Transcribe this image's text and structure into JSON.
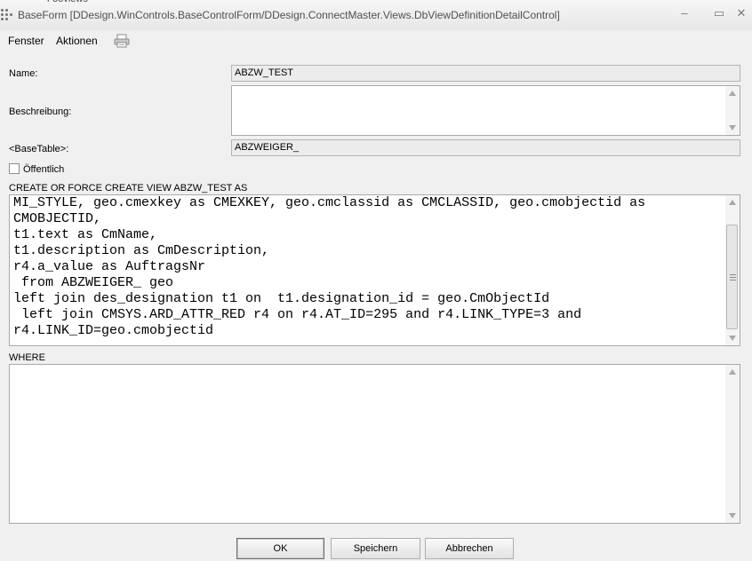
{
  "window": {
    "title": "BaseForm [DDesign.WinControls.BaseControlForm/DDesign.ConnectMaster.Views.DbViewDefinitionDetailControl]",
    "behind_text": "l-ooviews"
  },
  "menu": {
    "items": [
      "Fenster",
      "Aktionen"
    ]
  },
  "form": {
    "name_label": "Name:",
    "name_value": "ABZW_TEST",
    "description_label": "Beschreibung:",
    "description_value": "",
    "basetable_label": "<BaseTable>:",
    "basetable_value": "ABZWEIGER_",
    "public_label": "Öffentlich",
    "public_checked": false,
    "create_label": "CREATE OR FORCE CREATE VIEW ABZW_TEST AS",
    "sql_text": "MI_STYLE, geo.cmexkey as CMEXKEY, geo.cmclassid as CMCLASSID, geo.cmobjectid as\nCMOBJECTID,\nt1.text as CmName,\nt1.description as CmDescription,\nr4.a_value as AuftragsNr\n from ABZWEIGER_ geo\nleft join des_designation t1 on  t1.designation_id = geo.CmObjectId\n left join CMSYS.ARD_ATTR_RED r4 on r4.AT_ID=295 and r4.LINK_TYPE=3 and\nr4.LINK_ID=geo.cmobjectid",
    "where_label": "WHERE",
    "where_value": ""
  },
  "buttons": {
    "ok": "OK",
    "save": "Speichern",
    "cancel": "Abbrechen"
  }
}
